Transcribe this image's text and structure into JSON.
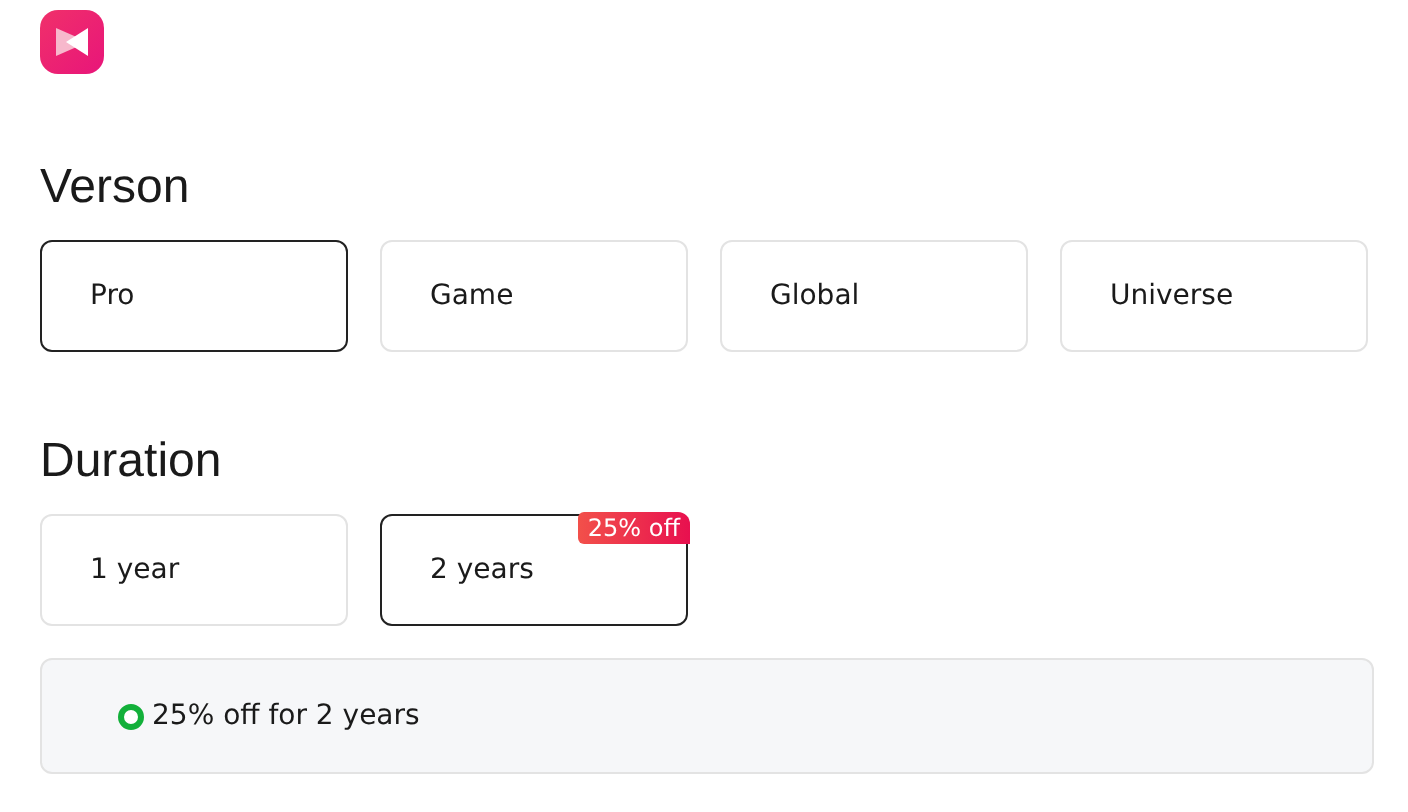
{
  "sections": [
    {
      "title": "Verson",
      "options": [
        {
          "label": "Pro",
          "selected": true
        },
        {
          "label": "Game",
          "selected": false
        },
        {
          "label": "Global",
          "selected": false
        },
        {
          "label": "Universe",
          "selected": false
        }
      ]
    },
    {
      "title": "Duration",
      "options": [
        {
          "label": "1 year",
          "selected": false
        },
        {
          "label": "2 years",
          "selected": true,
          "badge": "25% off"
        }
      ]
    }
  ],
  "summary": {
    "text": "25% off for 2 years"
  }
}
